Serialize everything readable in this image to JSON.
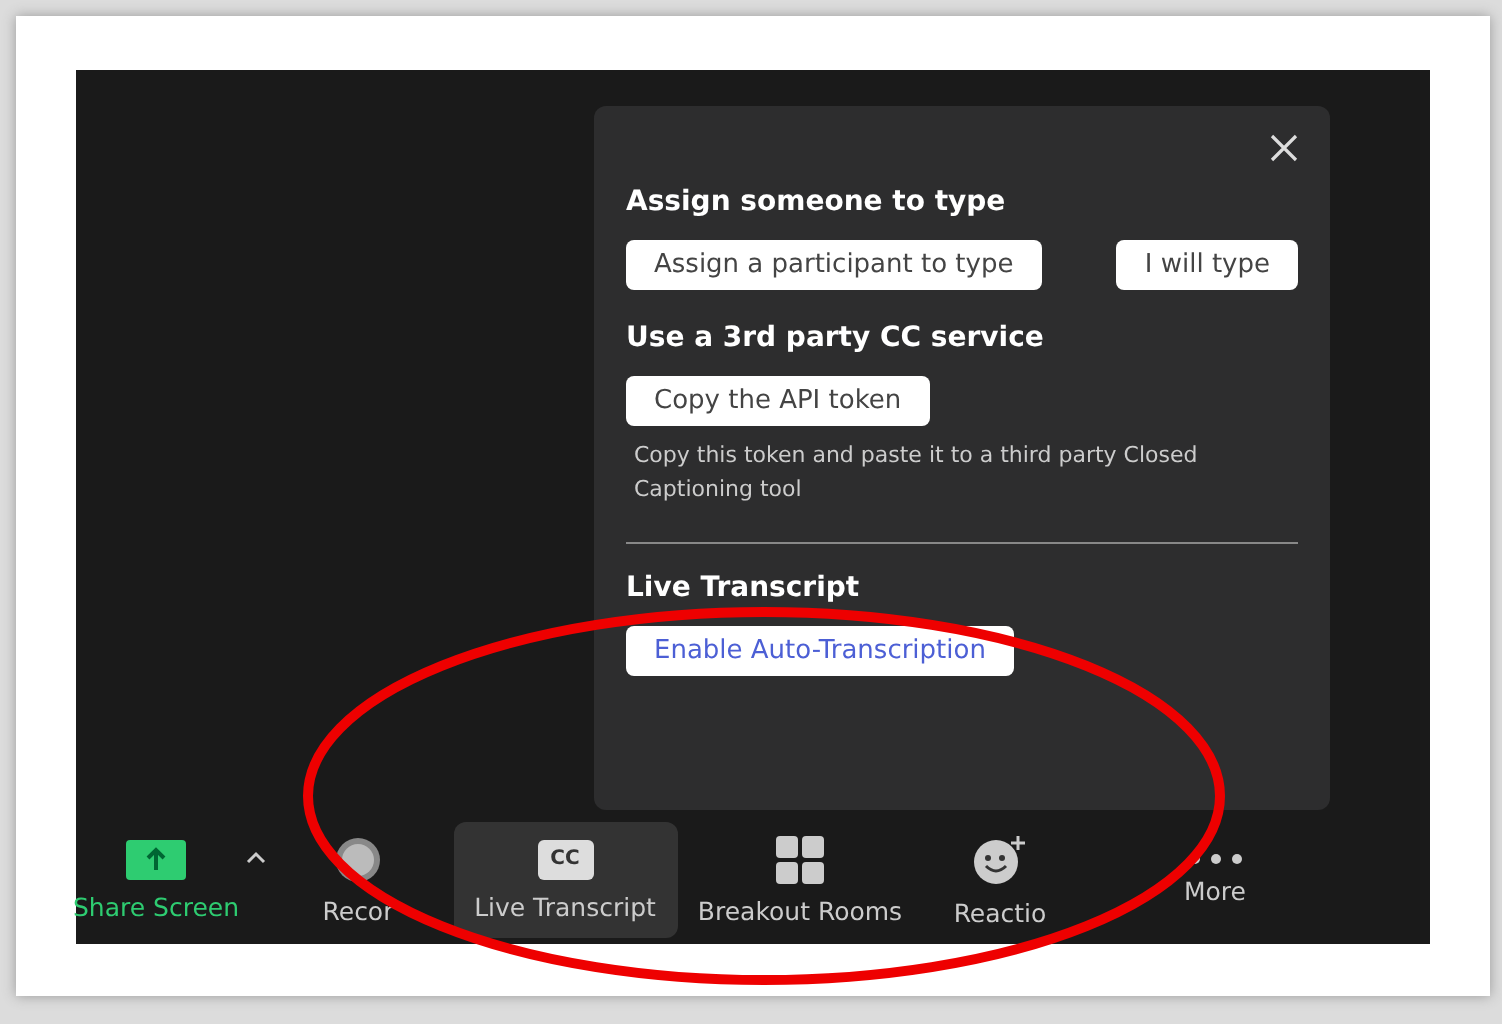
{
  "popup": {
    "sections": [
      {
        "title": "Assign someone to type",
        "buttons": [
          "Assign a participant to type",
          "I will type"
        ]
      },
      {
        "title": "Use a 3rd party CC service",
        "buttons": [
          "Copy the API token"
        ],
        "note": "Copy this token and paste it to a third party Closed Captioning tool"
      },
      {
        "title": "Live Transcript",
        "buttons": [
          "Enable Auto-Transcription"
        ],
        "link_style": true
      }
    ]
  },
  "toolbar": {
    "items": [
      {
        "kind": "share",
        "label": "Share Screen",
        "selected": false
      },
      {
        "kind": "caret"
      },
      {
        "kind": "record",
        "label": "Recor",
        "selected": false
      },
      {
        "kind": "cc",
        "label": "Live Transcript",
        "icon_text": "CC",
        "selected": true
      },
      {
        "kind": "grid",
        "label": "Breakout Rooms",
        "selected": false
      },
      {
        "kind": "reaction",
        "label": "Reactio",
        "selected": false
      },
      {
        "kind": "more",
        "label": "More",
        "selected": false
      }
    ]
  }
}
